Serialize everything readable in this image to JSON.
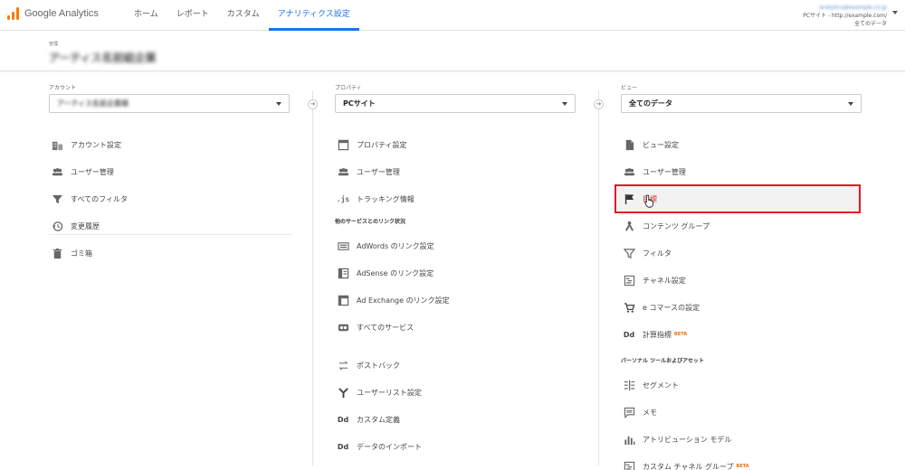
{
  "header": {
    "app_name": "Google Analytics",
    "nav": [
      "ホーム",
      "レポート",
      "カスタム",
      "アナリティクス設定"
    ],
    "active_nav": "アナリティクス設定",
    "account_email": "analytics@example.co.jp",
    "property_line": "PCサイト - http://example.com/",
    "view_line": "全てのデータ"
  },
  "admin": {
    "label": "管理",
    "account_name": "アーティス名前組企業"
  },
  "account_col": {
    "label": "アカウント",
    "selected": "アーティス名前企業様",
    "items": [
      {
        "icon": "building-icon",
        "label": "アカウント設定"
      },
      {
        "icon": "users-icon",
        "label": "ユーザー管理"
      },
      {
        "icon": "filter-icon",
        "label": "すべてのフィルタ"
      },
      {
        "icon": "history-icon",
        "label": "変更履歴"
      },
      {
        "icon": "trash-icon",
        "label": "ゴミ箱"
      }
    ]
  },
  "property_col": {
    "label": "プロパティ",
    "selected": "PCサイト",
    "items": [
      {
        "icon": "window-icon",
        "label": "プロパティ設定"
      },
      {
        "icon": "users-icon",
        "label": "ユーザー管理"
      },
      {
        "icon": "js-icon",
        "label": "トラッキング情報"
      }
    ],
    "link_section": "他のサービスとのリンク状況",
    "link_items": [
      {
        "icon": "adwords-icon",
        "label": "AdWords のリンク設定"
      },
      {
        "icon": "adsense-icon",
        "label": "AdSense のリンク設定"
      },
      {
        "icon": "adexchange-icon",
        "label": "Ad Exchange のリンク設定"
      },
      {
        "icon": "link-icon",
        "label": "すべてのサービス"
      }
    ],
    "extra_items": [
      {
        "icon": "postback-icon",
        "label": "ポストバック"
      },
      {
        "icon": "fork-icon",
        "label": "ユーザーリスト設定"
      },
      {
        "icon": "dd-icon",
        "label": "カスタム定義"
      },
      {
        "icon": "dd-icon",
        "label": "データのインポート"
      }
    ]
  },
  "view_col": {
    "label": "ビュー",
    "selected": "全てのデータ",
    "items": [
      {
        "icon": "document-icon",
        "label": "ビュー設定"
      },
      {
        "icon": "users-icon",
        "label": "ユーザー管理"
      },
      {
        "icon": "flag-icon",
        "label": "目標"
      },
      {
        "icon": "content-group-icon",
        "label": "コンテンツ グループ"
      },
      {
        "icon": "filter-icon",
        "label": "フィルタ"
      },
      {
        "icon": "channel-icon",
        "label": "チャネル設定"
      },
      {
        "icon": "cart-icon",
        "label": "e コマースの設定"
      },
      {
        "icon": "dd-icon",
        "label": "計算指標",
        "badge": "BETA"
      }
    ],
    "personal_section": "パーソナル ツールおよびアセット",
    "personal_items": [
      {
        "icon": "segment-icon",
        "label": "セグメント"
      },
      {
        "icon": "memo-icon",
        "label": "メモ"
      },
      {
        "icon": "attribution-icon",
        "label": "アトリビューション モデル"
      },
      {
        "icon": "channel-icon",
        "label": "カスタム チャネル グループ",
        "badge": "BETA"
      }
    ]
  },
  "colors": {
    "accent": "#1a73e8",
    "highlight_border": "#e01b24",
    "highlight_text": "#d93025",
    "logo": "#f57c00",
    "beta": "#e8710a"
  }
}
